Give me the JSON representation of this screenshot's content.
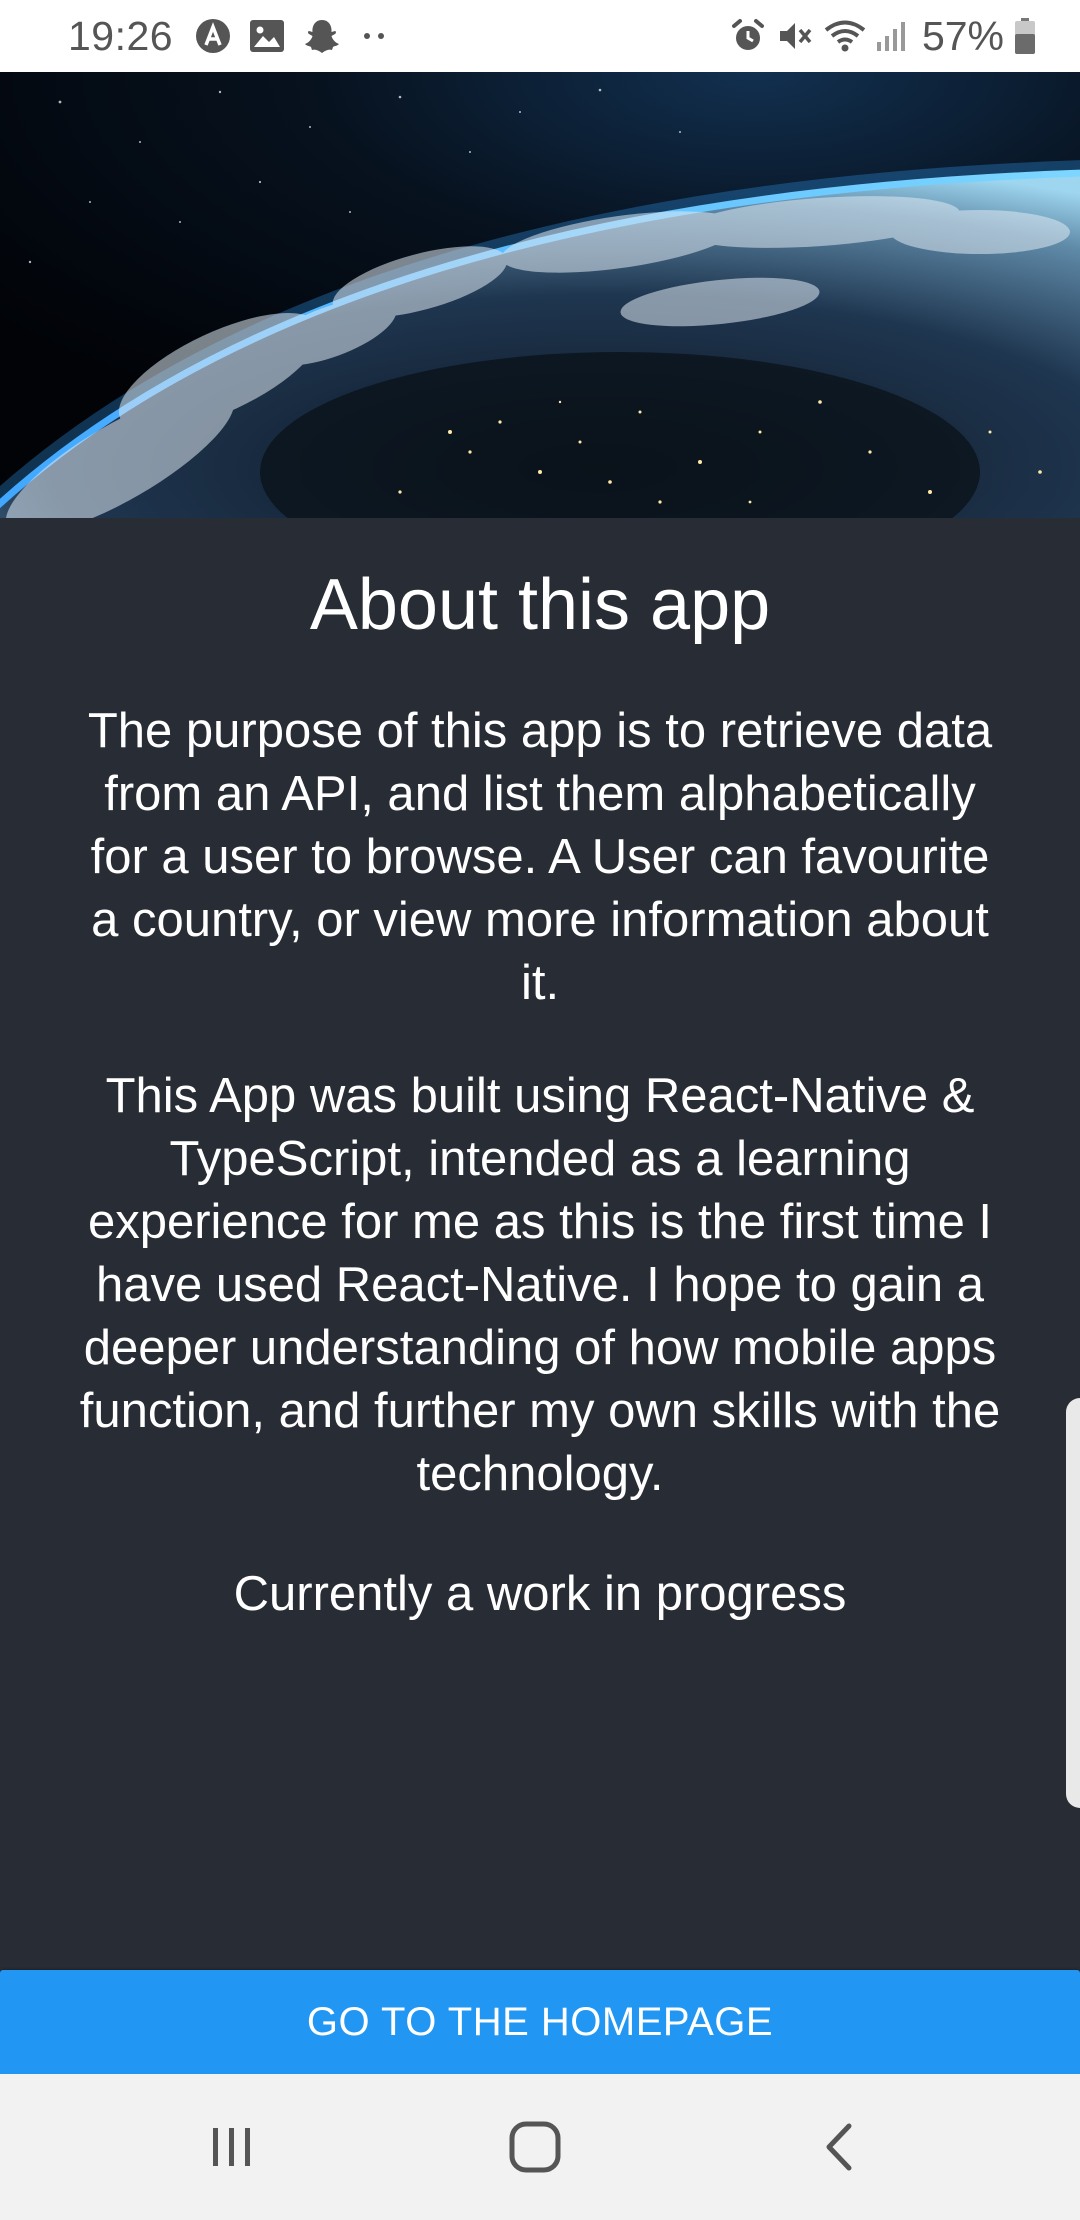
{
  "status_bar": {
    "time": "19:26",
    "left_icons": [
      "app-a-icon",
      "gallery-icon",
      "snapchat-icon",
      "more-dots-icon"
    ],
    "right_icons": [
      "alarm-icon",
      "vibrate-mute-icon",
      "wifi-icon",
      "signal-icon",
      "battery-icon"
    ],
    "battery_percent": "57%"
  },
  "hero": {
    "image": "earth-from-space-image"
  },
  "content": {
    "title": "About this app",
    "paragraph_1": "The purpose of this app is to retrieve data from an API, and list them alphabetically for a user to browse. A User can favourite a country, or view more information about it.",
    "paragraph_2": "This App was built using React-Native & TypeScript, intended as a learning experience for me as this is the first time I have used React-Native. I hope to gain a deeper understanding of how mobile apps function, and further my own skills with the technology.",
    "paragraph_3": "Currently a work in progress"
  },
  "button": {
    "label": "GO TO THE HOMEPAGE"
  },
  "nav_bar": {
    "icons": [
      "recent-apps-icon",
      "home-icon",
      "back-icon"
    ]
  },
  "colors": {
    "background": "#282c34",
    "button": "#2196f3",
    "status_bar": "#ffffff",
    "nav_bar": "#f2f2f2",
    "text": "#ffffff"
  }
}
